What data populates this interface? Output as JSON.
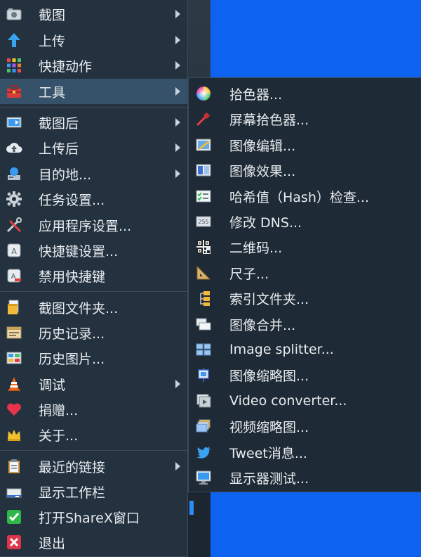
{
  "main_menu": {
    "items": [
      {
        "label": "截图",
        "icon": "screenshot-icon",
        "submenu": true
      },
      {
        "label": "上传",
        "icon": "upload-arrow-icon",
        "submenu": true
      },
      {
        "label": "快捷动作",
        "icon": "quick-actions-grid-icon",
        "submenu": true
      },
      {
        "label": "工具",
        "icon": "toolbox-icon",
        "submenu": true,
        "active": true
      },
      {
        "label": "截图后",
        "icon": "after-capture-icon",
        "submenu": true
      },
      {
        "label": "上传后",
        "icon": "after-upload-cloud-icon",
        "submenu": true
      },
      {
        "label": "目的地...",
        "icon": "destinations-icon",
        "submenu": true
      },
      {
        "label": "任务设置...",
        "icon": "gear-icon",
        "submenu": false
      },
      {
        "label": "应用程序设置...",
        "icon": "wrench-screwdriver-icon",
        "submenu": false
      },
      {
        "label": "快捷键设置...",
        "icon": "hotkey-icon",
        "submenu": false
      },
      {
        "label": "禁用快捷键",
        "icon": "disable-hotkey-icon",
        "submenu": false
      },
      {
        "label": "截图文件夹...",
        "icon": "folder-icon",
        "submenu": false
      },
      {
        "label": "历史记录...",
        "icon": "history-icon",
        "submenu": false
      },
      {
        "label": "历史图片...",
        "icon": "image-history-icon",
        "submenu": false
      },
      {
        "label": "调试",
        "icon": "traffic-cone-icon",
        "submenu": true
      },
      {
        "label": "捐赠...",
        "icon": "heart-icon",
        "submenu": false
      },
      {
        "label": "关于...",
        "icon": "crown-icon",
        "submenu": false
      },
      {
        "label": "最近的链接",
        "icon": "clipboard-icon",
        "submenu": true
      },
      {
        "label": "显示工作栏",
        "icon": "taskbar-icon",
        "submenu": false
      },
      {
        "label": "打开ShareX窗口",
        "icon": "check-icon",
        "submenu": false
      },
      {
        "label": "退出",
        "icon": "exit-x-icon",
        "submenu": false
      }
    ]
  },
  "tools_submenu": {
    "items": [
      {
        "label": "拾色器...",
        "icon": "color-wheel-icon"
      },
      {
        "label": "屏幕拾色器...",
        "icon": "eyedropper-icon"
      },
      {
        "label": "图像编辑...",
        "icon": "image-editor-icon"
      },
      {
        "label": "图像效果...",
        "icon": "image-effects-icon"
      },
      {
        "label": "哈希值（Hash）检查...",
        "icon": "checklist-icon"
      },
      {
        "label": "修改 DNS...",
        "icon": "dns-icon"
      },
      {
        "label": "二维码...",
        "icon": "qr-code-icon"
      },
      {
        "label": "尺子...",
        "icon": "ruler-icon"
      },
      {
        "label": "索引文件夹...",
        "icon": "index-folder-icon"
      },
      {
        "label": "图像合并...",
        "icon": "image-combiner-icon"
      },
      {
        "label": "Image splitter...",
        "icon": "image-splitter-icon"
      },
      {
        "label": "图像缩略图...",
        "icon": "image-thumbnail-icon"
      },
      {
        "label": "Video converter...",
        "icon": "video-converter-icon"
      },
      {
        "label": "视频缩略图...",
        "icon": "video-thumbnail-icon"
      },
      {
        "label": "Tweet消息...",
        "icon": "twitter-bird-icon"
      },
      {
        "label": "显示器测试...",
        "icon": "monitor-icon"
      }
    ]
  }
}
